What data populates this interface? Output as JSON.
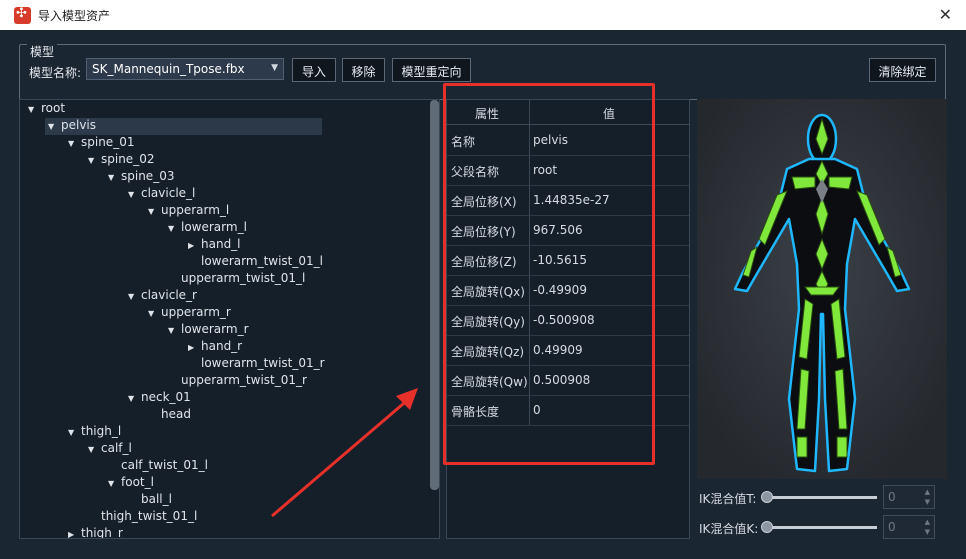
{
  "window": {
    "title": "导入模型资产",
    "close_icon": "close-icon"
  },
  "model": {
    "group_label": "模型",
    "name_label": "模型名称:",
    "selected_model": "SK_Mannequin_Tpose.fbx",
    "buttons": {
      "import": "导入",
      "remove": "移除",
      "retarget": "模型重定向",
      "clear_binding": "清除绑定"
    }
  },
  "tree": [
    {
      "label": "root",
      "depth": 0,
      "expanded": true
    },
    {
      "label": "pelvis",
      "depth": 1,
      "expanded": true,
      "selected": true
    },
    {
      "label": "spine_01",
      "depth": 2,
      "expanded": true
    },
    {
      "label": "spine_02",
      "depth": 3,
      "expanded": true
    },
    {
      "label": "spine_03",
      "depth": 4,
      "expanded": true
    },
    {
      "label": "clavicle_l",
      "depth": 5,
      "expanded": true
    },
    {
      "label": "upperarm_l",
      "depth": 6,
      "expanded": true
    },
    {
      "label": "lowerarm_l",
      "depth": 7,
      "expanded": true
    },
    {
      "label": "hand_l",
      "depth": 8,
      "expanded": false
    },
    {
      "label": "lowerarm_twist_01_l",
      "depth": 8,
      "leaf": true
    },
    {
      "label": "upperarm_twist_01_l",
      "depth": 7,
      "leaf": true
    },
    {
      "label": "clavicle_r",
      "depth": 5,
      "expanded": true
    },
    {
      "label": "upperarm_r",
      "depth": 6,
      "expanded": true
    },
    {
      "label": "lowerarm_r",
      "depth": 7,
      "expanded": true
    },
    {
      "label": "hand_r",
      "depth": 8,
      "expanded": false
    },
    {
      "label": "lowerarm_twist_01_r",
      "depth": 8,
      "leaf": true
    },
    {
      "label": "upperarm_twist_01_r",
      "depth": 7,
      "leaf": true
    },
    {
      "label": "neck_01",
      "depth": 5,
      "expanded": true
    },
    {
      "label": "head",
      "depth": 6,
      "leaf": true
    },
    {
      "label": "thigh_l",
      "depth": 2,
      "expanded": true
    },
    {
      "label": "calf_l",
      "depth": 3,
      "expanded": true
    },
    {
      "label": "calf_twist_01_l",
      "depth": 4,
      "leaf": true
    },
    {
      "label": "foot_l",
      "depth": 4,
      "expanded": true
    },
    {
      "label": "ball_l",
      "depth": 5,
      "leaf": true
    },
    {
      "label": "thigh_twist_01_l",
      "depth": 3,
      "leaf": true
    },
    {
      "label": "thigh_r",
      "depth": 2,
      "expanded": false
    }
  ],
  "properties": {
    "header": {
      "key": "属性",
      "value": "值"
    },
    "rows": [
      {
        "key": "名称",
        "value": "pelvis"
      },
      {
        "key": "父段名称",
        "value": "root"
      },
      {
        "key": "全局位移(X)",
        "value": "1.44835e-27"
      },
      {
        "key": "全局位移(Y)",
        "value": "967.506"
      },
      {
        "key": "全局位移(Z)",
        "value": "-10.5615"
      },
      {
        "key": "全局旋转(Qx)",
        "value": "-0.49909"
      },
      {
        "key": "全局旋转(Qy)",
        "value": "-0.500908"
      },
      {
        "key": "全局旋转(Qz)",
        "value": "0.49909"
      },
      {
        "key": "全局旋转(Qw)",
        "value": "0.500908"
      },
      {
        "key": "骨骼长度",
        "value": "0"
      }
    ]
  },
  "ik": {
    "t_label": "IK混合值T:",
    "t_value": "0",
    "k_label": "IK混合值K:",
    "k_value": "0"
  },
  "colors": {
    "highlight": "#e8302a",
    "bone": "#7fe83a",
    "outline": "#1fb7ff"
  }
}
